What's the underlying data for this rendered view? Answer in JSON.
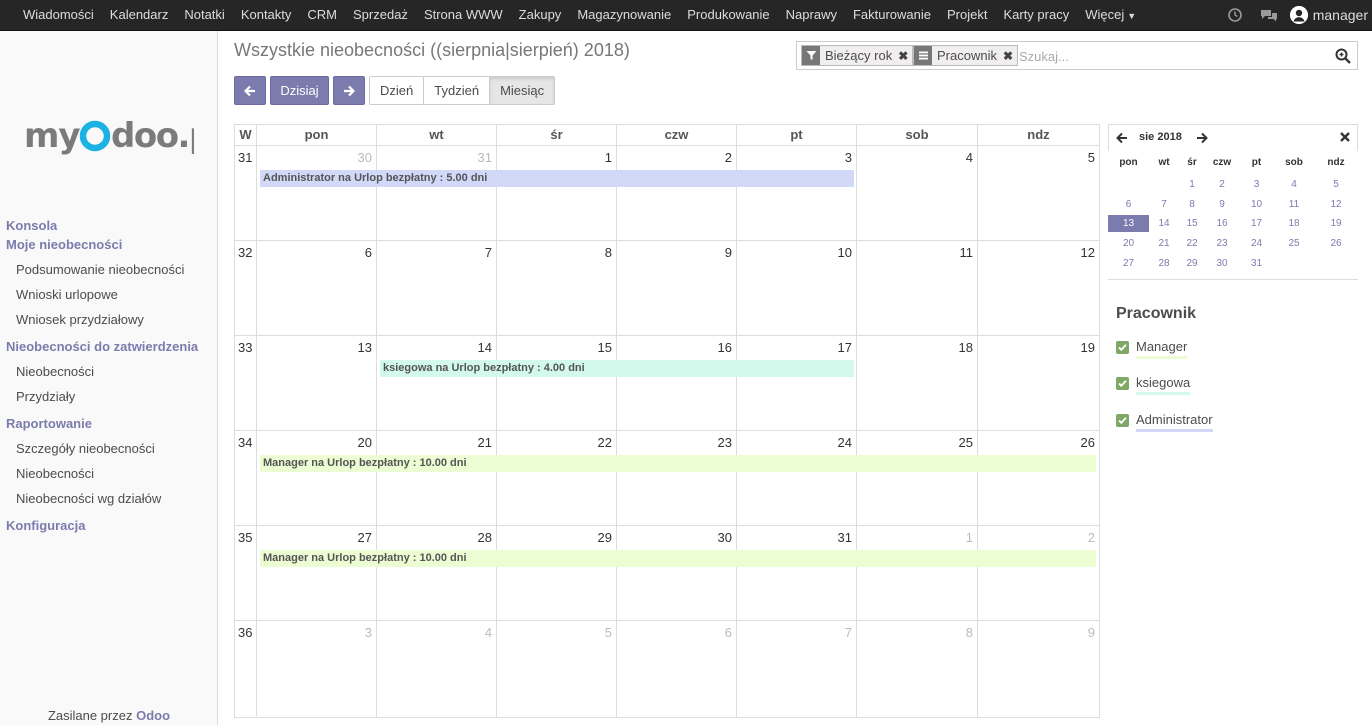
{
  "topbar": {
    "menu": [
      "Wiadomości",
      "Kalendarz",
      "Notatki",
      "Kontakty",
      "CRM",
      "Sprzedaż",
      "Strona WWW",
      "Zakupy",
      "Magazynowanie",
      "Produkowanie",
      "Naprawy",
      "Fakturowanie",
      "Projekt",
      "Karty pracy",
      "Więcej"
    ],
    "user": "manager"
  },
  "sidebar": {
    "logo_text_part1": "my",
    "logo_text_part2": "O",
    "logo_text_part3": "doo.pl",
    "sections": [
      {
        "title": "Konsola",
        "items": []
      },
      {
        "title": "Moje nieobecności",
        "items": [
          "Podsumowanie nieobecności",
          "Wnioski urlopowe",
          "Wniosek przydziałowy"
        ]
      },
      {
        "title": "Nieobecności do zatwierdzenia",
        "items": [
          "Nieobecności",
          "Przydziały"
        ]
      },
      {
        "title": "Raportowanie",
        "items": [
          "Szczegóły nieobecności",
          "Nieobecności",
          "Nieobecności wg działów"
        ]
      },
      {
        "title": "Konfiguracja",
        "items": []
      }
    ],
    "powered_prefix": "Zasilane przez",
    "powered_brand": "Odoo"
  },
  "control": {
    "title": "Wszystkie nieobecności ((sierpnia|sierpień) 2018)",
    "today_label": "Dzisiaj",
    "views": [
      "Dzień",
      "Tydzień",
      "Miesiąc"
    ],
    "active_view": "Miesiąc"
  },
  "search": {
    "facets": [
      {
        "label": "Bieżący rok",
        "icon": "filter-icon"
      },
      {
        "label": "Pracownik",
        "icon": "group-by-icon"
      }
    ],
    "placeholder": "Szukaj..."
  },
  "calendar": {
    "week_header": "W",
    "weekdays": [
      "pon",
      "wt",
      "śr",
      "czw",
      "pt",
      "sob",
      "ndz"
    ],
    "weeks": [
      {
        "num": "31",
        "days": [
          {
            "d": "30",
            "o": true
          },
          {
            "d": "31",
            "o": true
          },
          {
            "d": "1"
          },
          {
            "d": "2"
          },
          {
            "d": "3"
          },
          {
            "d": "4"
          },
          {
            "d": "5"
          }
        ]
      },
      {
        "num": "32",
        "days": [
          {
            "d": "6"
          },
          {
            "d": "7"
          },
          {
            "d": "8"
          },
          {
            "d": "9"
          },
          {
            "d": "10"
          },
          {
            "d": "11"
          },
          {
            "d": "12"
          }
        ]
      },
      {
        "num": "33",
        "days": [
          {
            "d": "13"
          },
          {
            "d": "14"
          },
          {
            "d": "15"
          },
          {
            "d": "16"
          },
          {
            "d": "17"
          },
          {
            "d": "18"
          },
          {
            "d": "19"
          }
        ]
      },
      {
        "num": "34",
        "days": [
          {
            "d": "20"
          },
          {
            "d": "21"
          },
          {
            "d": "22"
          },
          {
            "d": "23"
          },
          {
            "d": "24"
          },
          {
            "d": "25"
          },
          {
            "d": "26"
          }
        ]
      },
      {
        "num": "35",
        "days": [
          {
            "d": "27"
          },
          {
            "d": "28"
          },
          {
            "d": "29"
          },
          {
            "d": "30"
          },
          {
            "d": "31"
          },
          {
            "d": "1",
            "o": true
          },
          {
            "d": "2",
            "o": true
          }
        ]
      },
      {
        "num": "36",
        "days": [
          {
            "d": "3",
            "o": true
          },
          {
            "d": "4",
            "o": true
          },
          {
            "d": "5",
            "o": true
          },
          {
            "d": "6",
            "o": true
          },
          {
            "d": "7",
            "o": true
          },
          {
            "d": "8",
            "o": true
          },
          {
            "d": "9",
            "o": true
          }
        ]
      }
    ],
    "events": [
      {
        "text": "Administrator na Urlop bezpłatny : 5.00 dni",
        "week": 0,
        "start": 0,
        "end": 4,
        "color": "#d1d8f8"
      },
      {
        "text": "ksiegowa na Urlop bezpłatny : 4.00 dni",
        "week": 2,
        "start": 1,
        "end": 4,
        "color": "#d3f8ec"
      },
      {
        "text": "Manager na Urlop bezpłatny : 10.00 dni",
        "week": 3,
        "start": 0,
        "end": 6,
        "color": "#ecfdd4"
      },
      {
        "text": "Manager na Urlop bezpłatny : 10.00 dni",
        "week": 4,
        "start": 0,
        "end": 6,
        "color": "#ecfdd4"
      }
    ]
  },
  "mini_calendar": {
    "month_label": "sie 2018",
    "weekdays": [
      "pon",
      "wt",
      "śr",
      "czw",
      "pt",
      "sob",
      "ndz"
    ],
    "rows": [
      [
        "",
        "",
        "1",
        "2",
        "3",
        "4",
        "5"
      ],
      [
        "6",
        "7",
        "8",
        "9",
        "10",
        "11",
        "12"
      ],
      [
        "13",
        "14",
        "15",
        "16",
        "17",
        "18",
        "19"
      ],
      [
        "20",
        "21",
        "22",
        "23",
        "24",
        "25",
        "26"
      ],
      [
        "27",
        "28",
        "29",
        "30",
        "31",
        "",
        ""
      ]
    ],
    "selected": "13"
  },
  "attendees": {
    "title": "Pracownik",
    "items": [
      {
        "name": "Manager",
        "color": "#ecfdd4"
      },
      {
        "name": "ksiegowa",
        "color": "#d3f8ec"
      },
      {
        "name": "Administrator",
        "color": "#d1d8f8"
      }
    ]
  },
  "colors": {
    "accent": "#7c7bad",
    "navbar": "#262626"
  }
}
